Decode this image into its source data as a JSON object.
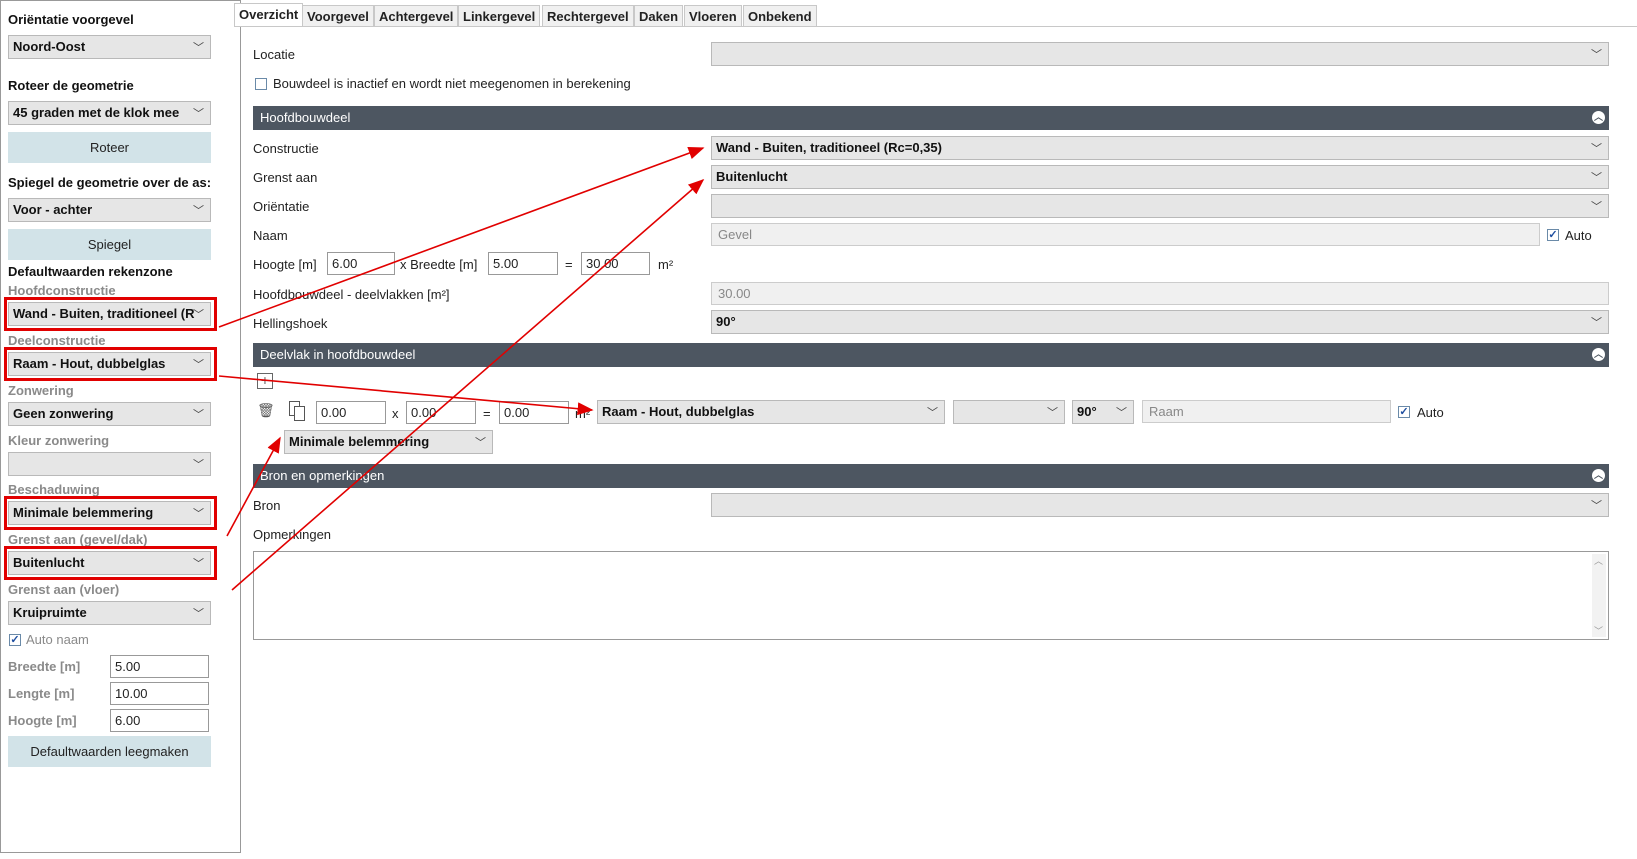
{
  "left": {
    "orientation_label": "Oriëntatie voorgevel",
    "orientation_value": "Noord-Oost",
    "rotate_label": "Roteer de geometrie",
    "rotate_value": "45 graden met de klok mee",
    "rotate_button": "Roteer",
    "mirror_label": "Spiegel de geometrie over de as:",
    "mirror_value": "Voor - achter",
    "mirror_button": "Spiegel",
    "defaults_title": "Defaultwaarden rekenzone",
    "hoofdconstructie_label": "Hoofdconstructie",
    "hoofdconstructie_value": "Wand - Buiten, traditioneel (R",
    "deelconstructie_label": "Deelconstructie",
    "deelconstructie_value": "Raam - Hout, dubbelglas",
    "zonwering_label": "Zonwering",
    "zonwering_value": "Geen zonwering",
    "kleur_label": "Kleur zonwering",
    "kleur_value": "",
    "beschaduwing_label": "Beschaduwing",
    "beschaduwing_value": "Minimale belemmering",
    "grenst_gevel_label": "Grenst aan (gevel/dak)",
    "grenst_gevel_value": "Buitenlucht",
    "grenst_vloer_label": "Grenst aan (vloer)",
    "grenst_vloer_value": "Kruipruimte",
    "auto_naam_label": "Auto naam",
    "auto_naam_checked": true,
    "breedte_label": "Breedte [m]",
    "breedte_value": "5.00",
    "lengte_label": "Lengte [m]",
    "lengte_value": "10.00",
    "hoogte_label": "Hoogte [m]",
    "hoogte_value": "6.00",
    "clear_button": "Defaultwaarden leegmaken"
  },
  "tabs": [
    "Overzicht",
    "Voorgevel",
    "Achtergevel",
    "Linkergevel",
    "Rechtergevel",
    "Daken",
    "Vloeren",
    "Onbekend"
  ],
  "active_tab": "Overzicht",
  "main": {
    "locatie_label": "Locatie",
    "locatie_value": "",
    "inactive_label": "Bouwdeel is inactief en wordt niet meegenomen in berekening",
    "inactive_checked": false,
    "hoofd_section": "Hoofdbouwdeel",
    "constructie_label": "Constructie",
    "constructie_value": "Wand - Buiten, traditioneel (Rc=0,35)",
    "grenst_label": "Grenst aan",
    "grenst_value": "Buitenlucht",
    "orientatie_label": "Oriëntatie",
    "orientatie_value": "",
    "naam_label": "Naam",
    "naam_value": "Gevel",
    "naam_auto_label": "Auto",
    "naam_auto_checked": true,
    "hoogte_label": "Hoogte [m]",
    "hoogte_value": "6.00",
    "breedte_label": "x Breedte [m]",
    "breedte_value": "5.00",
    "equals": "=",
    "area_value": "30.00",
    "area_unit": "m²",
    "hoofd_deelvlakken_label": "Hoofdbouwdeel - deelvlakken [m²]",
    "hoofd_deelvlakken_value": "30.00",
    "hellingshoek_label": "Hellingshoek",
    "hellingshoek_value": "90°",
    "deel_section": "Deelvlak in hoofdbouwdeel",
    "deel_h": "0.00",
    "deel_x": "x",
    "deel_b": "0.00",
    "deel_eq": "=",
    "deel_area": "0.00",
    "deel_unit": "m²",
    "deel_constructie": "Raam - Hout, dubbelglas",
    "deel_orient": "",
    "deel_angle": "90°",
    "deel_name": "Raam",
    "deel_auto_label": "Auto",
    "deel_auto_checked": true,
    "deel_beschaduwing": "Minimale belemmering",
    "bron_section": "Bron en opmerkingen",
    "bron_label": "Bron",
    "bron_value": "",
    "opmerkingen_label": "Opmerkingen",
    "opmerkingen_value": ""
  },
  "icons": {
    "chevron": "chevron-down-icon",
    "collapse": "collapse-up-icon",
    "add": "add-icon",
    "delete": "delete-icon",
    "copy": "copy-icon"
  },
  "colors": {
    "section_header": "#4d5661",
    "button_bg": "#d2e3e8",
    "highlight_red": "#e10000",
    "select_bg": "#e6e6e6"
  }
}
